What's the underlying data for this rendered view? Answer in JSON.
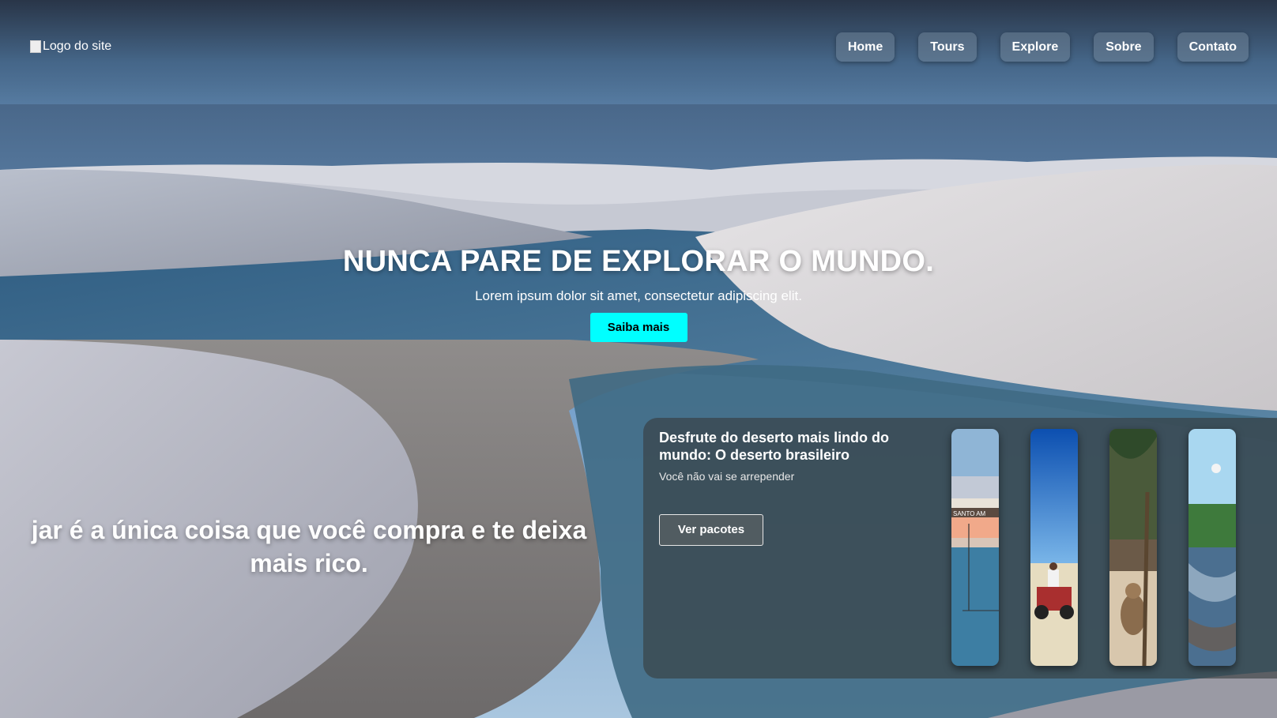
{
  "header": {
    "logo_alt": "Logo do site",
    "nav": [
      {
        "label": "Home"
      },
      {
        "label": "Tours"
      },
      {
        "label": "Explore"
      },
      {
        "label": "Sobre"
      },
      {
        "label": "Contato"
      }
    ]
  },
  "hero": {
    "title": "NUNCA PARE DE EXPLORAR O MUNDO.",
    "subtitle": "Lorem ipsum dolor sit amet, consectetur adipiscing elit.",
    "cta": "Saiba mais"
  },
  "quote": "jar é a única coisa que você compra e te deixa\nmais rico.",
  "card": {
    "title": "Desfrute do deserto mais lindo do mundo: O deserto brasileiro",
    "subtitle": "Você não vai se arrepender",
    "button": "Ver pacotes",
    "thumb_sign_text": "SANTO AM"
  },
  "colors": {
    "cta_bg": "#00ffff",
    "card_bg": "rgba(55,60,62,0.62)",
    "nav_bg": "rgba(110,130,150,0.55)"
  }
}
